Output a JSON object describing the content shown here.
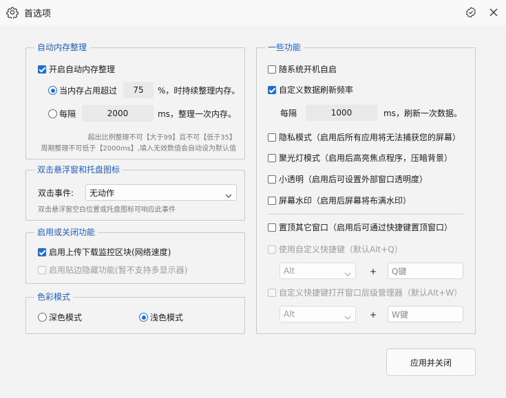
{
  "window": {
    "title": "首选项",
    "icons": {
      "app": "gear-icon",
      "pin": "pin-check-icon",
      "close": "close-icon"
    }
  },
  "memory": {
    "title": "自动内存整理",
    "enable_label": "开启自动内存整理",
    "enable_checked": true,
    "threshold": {
      "prefix": "当内存占用超过",
      "value": "75",
      "suffix": "%，时持续整理内存。",
      "selected": true
    },
    "interval": {
      "prefix": "每隔",
      "value": "2000",
      "suffix": "ms，整理一次内存。",
      "selected": false
    },
    "hint1": "超出比例整理不可【大于99】且不可【低于35】",
    "hint2": "周期整理不可低于【2000ms】,填入无效数值会自动设为默认值"
  },
  "float": {
    "title": "双击悬浮窗和托盘图标",
    "event_label": "双击事件:",
    "event_value": "无动作",
    "hint": "双击悬浮窗空白位置或托盘图标可响应此事件"
  },
  "toggles": {
    "title": "启用或关闭功能",
    "items": [
      {
        "label": "启用上传下载监控区块(网络速度)",
        "checked": true,
        "disabled": false
      },
      {
        "label": "启用贴边隐藏功能(暂不支持多显示器)",
        "checked": false,
        "disabled": true
      }
    ]
  },
  "color": {
    "title": "色彩模式",
    "dark": "深色模式",
    "light": "浅色模式",
    "selected": "light"
  },
  "features": {
    "title": "一些功能",
    "autostart": {
      "label": "随系统开机自启",
      "checked": false
    },
    "refresh": {
      "label": "自定义数据刷新频率",
      "checked": true
    },
    "refresh_interval": {
      "prefix": "每隔",
      "value": "1000",
      "suffix": "ms，刷新一次数据。"
    },
    "privacy": {
      "label": "隐私模式（启用后所有应用将无法捕获您的屏幕）",
      "checked": false
    },
    "spotlight": {
      "label": "聚光灯模式（启用后高亮焦点程序，压暗背景）",
      "checked": false
    },
    "transparent": {
      "label": "小透明（启用后可设置外部窗口透明度）",
      "checked": false
    },
    "watermark": {
      "label": "屏幕水印（启用后屏幕将布满水印）",
      "checked": false
    },
    "topmost": {
      "label": "置顶其它窗口（启用后可通过快捷键置顶窗口）",
      "checked": false
    },
    "hotkey1": {
      "label": "使用自定义快捷键（默认Alt+Q）",
      "checked": false,
      "modifier": "Alt",
      "plus": "+",
      "key": "Q键"
    },
    "hotkey2": {
      "label": "自定义快捷键打开窗口层级管理器（默认Alt+W）",
      "checked": false,
      "modifier": "Alt",
      "plus": "+",
      "key": "W键"
    }
  },
  "apply_button": "应用并关闭"
}
